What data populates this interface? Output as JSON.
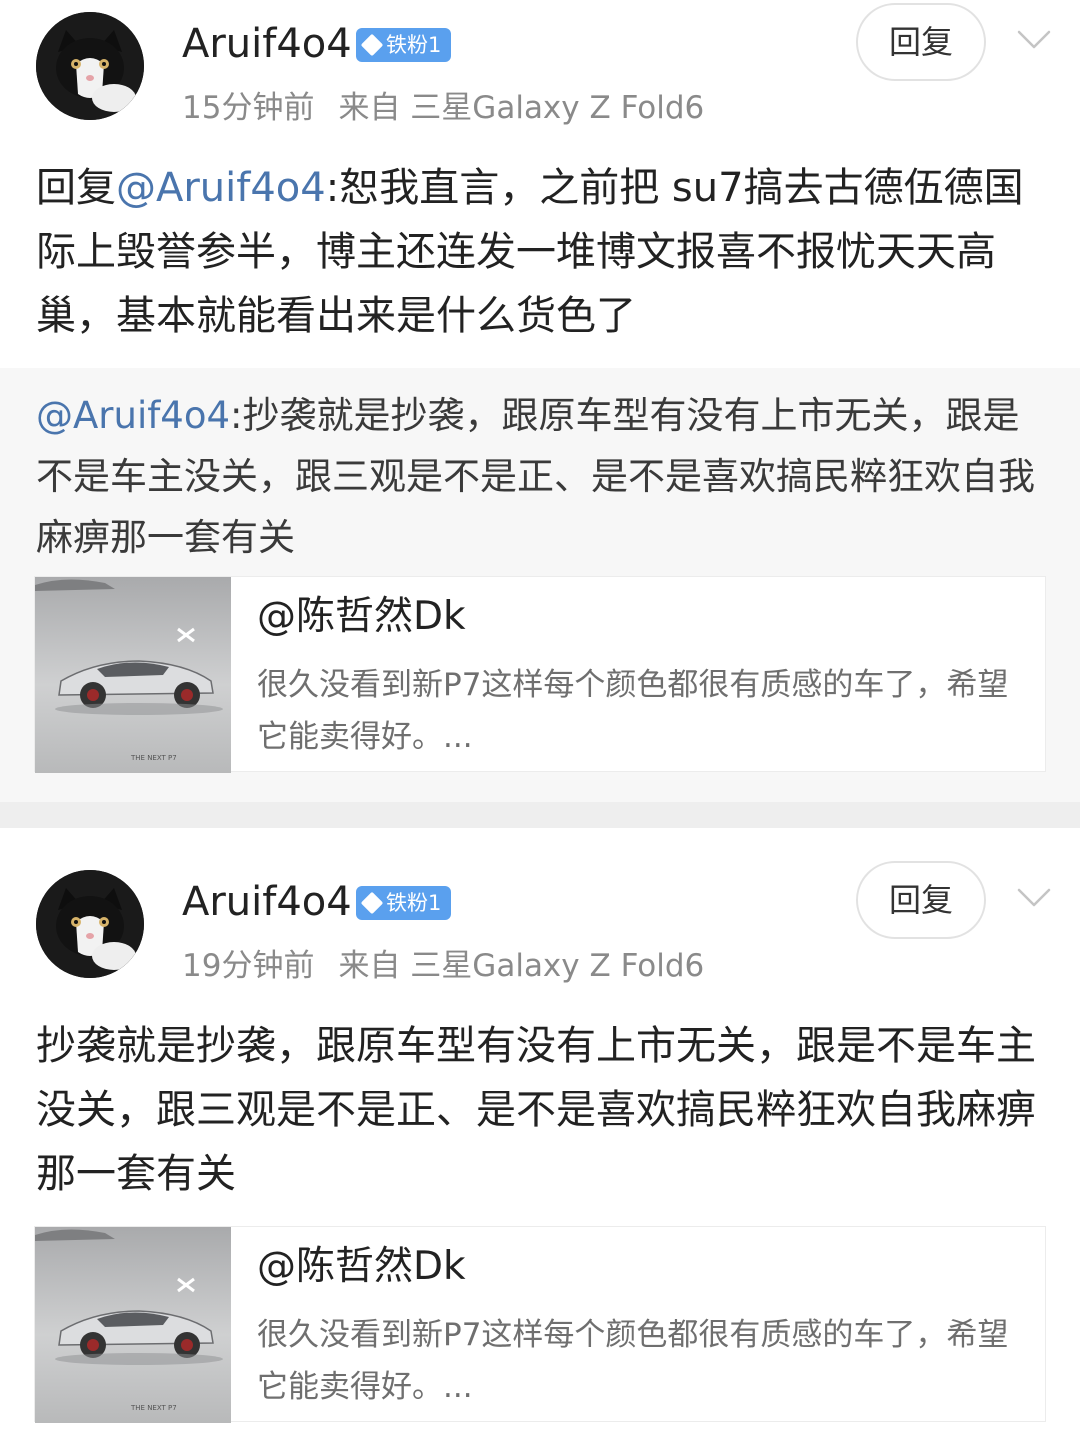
{
  "posts": [
    {
      "username": "Aruif4o4",
      "badge": "铁粉1",
      "time": "15分钟前",
      "source": "来自 三星Galaxy Z Fold6",
      "reply_label": "回复",
      "avatar_desc": "cat-avatar",
      "content_prefix": "回复",
      "content_mention": "@Aruif4o4",
      "content_text": ":恕我直言，之前把 su7搞去古德伍德国际上毁誉参半，博主还连发一堆博文报喜不报忧天天高巢，基本就能看出来是什么货色了",
      "quote": {
        "mention": "@Aruif4o4",
        "text": ":抄袭就是抄袭，跟原车型有没有上市无关，跟是不是车主没关，跟三观是不是正、是不是喜欢搞民粹狂欢自我麻痹那一套有关"
      },
      "card": {
        "author": "@陈哲然Dk",
        "excerpt": "很久没看到新P7这样每个颜色都很有质感的车了，希望它能卖得好。...",
        "thumb_caption": "THE NEXT P7"
      }
    },
    {
      "username": "Aruif4o4",
      "badge": "铁粉1",
      "time": "19分钟前",
      "source": "来自 三星Galaxy Z Fold6",
      "reply_label": "回复",
      "avatar_desc": "cat-avatar",
      "content_text": "抄袭就是抄袭，跟原车型有没有上市无关，跟是不是车主没关，跟三观是不是正、是不是喜欢搞民粹狂欢自我麻痹那一套有关",
      "card": {
        "author": "@陈哲然Dk",
        "excerpt": "很久没看到新P7这样每个颜色都很有质感的车了，希望它能卖得好。...",
        "thumb_caption": "THE NEXT P7"
      }
    }
  ],
  "colors": {
    "mention": "#4a75ad",
    "badge": "#5aa0ee",
    "meta": "#8a8a8a",
    "quote_bg": "#f7f7f7",
    "separator": "#eeeeee"
  }
}
